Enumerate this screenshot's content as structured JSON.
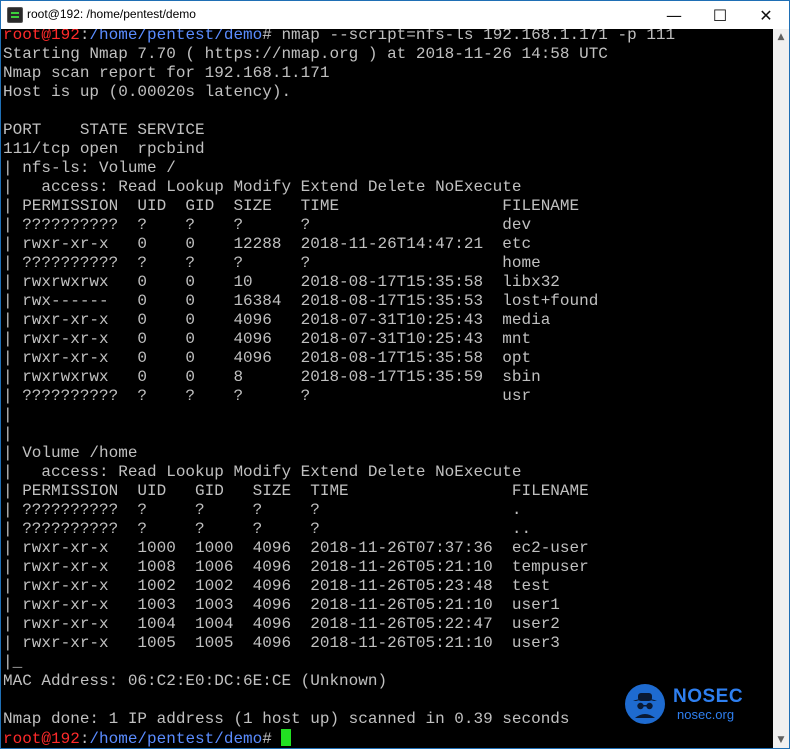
{
  "window": {
    "title": "root@192: /home/pentest/demo",
    "minimize_glyph": "—",
    "maximize_glyph": "☐",
    "close_glyph": "✕"
  },
  "colors": {
    "prompt_user": "#ff2a2a",
    "prompt_path": "#5a8cff",
    "terminal_text": "#c0c0c0",
    "cursor": "#22e022",
    "watermark": "#2e7ff0"
  },
  "prompt": {
    "user_host": "root@192",
    "sep": ":",
    "path": "/home/pentest/demo",
    "symbol": "# "
  },
  "command": "nmap --script=nfs-ls 192.168.1.171 -p 111",
  "output_lines": [
    "Starting Nmap 7.70 ( https://nmap.org ) at 2018-11-26 14:58 UTC",
    "Nmap scan report for 192.168.1.171",
    "Host is up (0.00020s latency).",
    "",
    "PORT    STATE SERVICE",
    "111/tcp open  rpcbind",
    "| nfs-ls: Volume /",
    "|   access: Read Lookup Modify Extend Delete NoExecute",
    "| PERMISSION  UID  GID  SIZE   TIME                 FILENAME",
    "| ??????????  ?    ?    ?      ?                    dev",
    "| rwxr-xr-x   0    0    12288  2018-11-26T14:47:21  etc",
    "| ??????????  ?    ?    ?      ?                    home",
    "| rwxrwxrwx   0    0    10     2018-08-17T15:35:58  libx32",
    "| rwx------   0    0    16384  2018-08-17T15:35:53  lost+found",
    "| rwxr-xr-x   0    0    4096   2018-07-31T10:25:43  media",
    "| rwxr-xr-x   0    0    4096   2018-07-31T10:25:43  mnt",
    "| rwxr-xr-x   0    0    4096   2018-08-17T15:35:58  opt",
    "| rwxrwxrwx   0    0    8      2018-08-17T15:35:59  sbin",
    "| ??????????  ?    ?    ?      ?                    usr",
    "|",
    "|",
    "| Volume /home",
    "|   access: Read Lookup Modify Extend Delete NoExecute",
    "| PERMISSION  UID   GID   SIZE  TIME                 FILENAME",
    "| ??????????  ?     ?     ?     ?                    .",
    "| ??????????  ?     ?     ?     ?                    ..",
    "| rwxr-xr-x   1000  1000  4096  2018-11-26T07:37:36  ec2-user",
    "| rwxr-xr-x   1008  1006  4096  2018-11-26T05:21:10  tempuser",
    "| rwxr-xr-x   1002  1002  4096  2018-11-26T05:23:48  test",
    "| rwxr-xr-x   1003  1003  4096  2018-11-26T05:21:10  user1",
    "| rwxr-xr-x   1004  1004  4096  2018-11-26T05:22:47  user2",
    "| rwxr-xr-x   1005  1005  4096  2018-11-26T05:21:10  user3",
    "|_",
    "MAC Address: 06:C2:E0:DC:6E:CE (Unknown)",
    "",
    "Nmap done: 1 IP address (1 host up) scanned in 0.39 seconds"
  ],
  "watermark": {
    "brand": "NOSEC",
    "domain": "nosec.org",
    "logo_icon": "spy-hat-icon"
  }
}
